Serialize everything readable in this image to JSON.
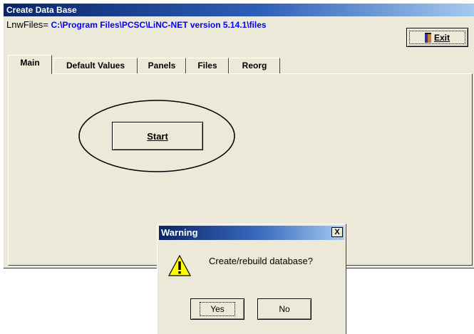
{
  "window": {
    "title": "Create Data Base",
    "path_label": "LnwFiles=",
    "path_value": "C:\\Program Files\\PCSC\\LiNC-NET version 5.14.1\\files",
    "exit_label": "Exit"
  },
  "tabs": [
    {
      "label": "Main"
    },
    {
      "label": "Default Values"
    },
    {
      "label": "Panels"
    },
    {
      "label": "Files"
    },
    {
      "label": "Reorg"
    }
  ],
  "main": {
    "start_label": "Start"
  },
  "dialog": {
    "title": "Warning",
    "close": "X",
    "message": "Create/rebuild database?",
    "yes_label": "Yes",
    "no_label": "No"
  },
  "colors": {
    "title_bar": "#0a246a",
    "face": "#ece9d8",
    "path_value": "#0000ff"
  },
  "icons": {
    "exit": "door-icon",
    "dialog": "warning-icon"
  }
}
